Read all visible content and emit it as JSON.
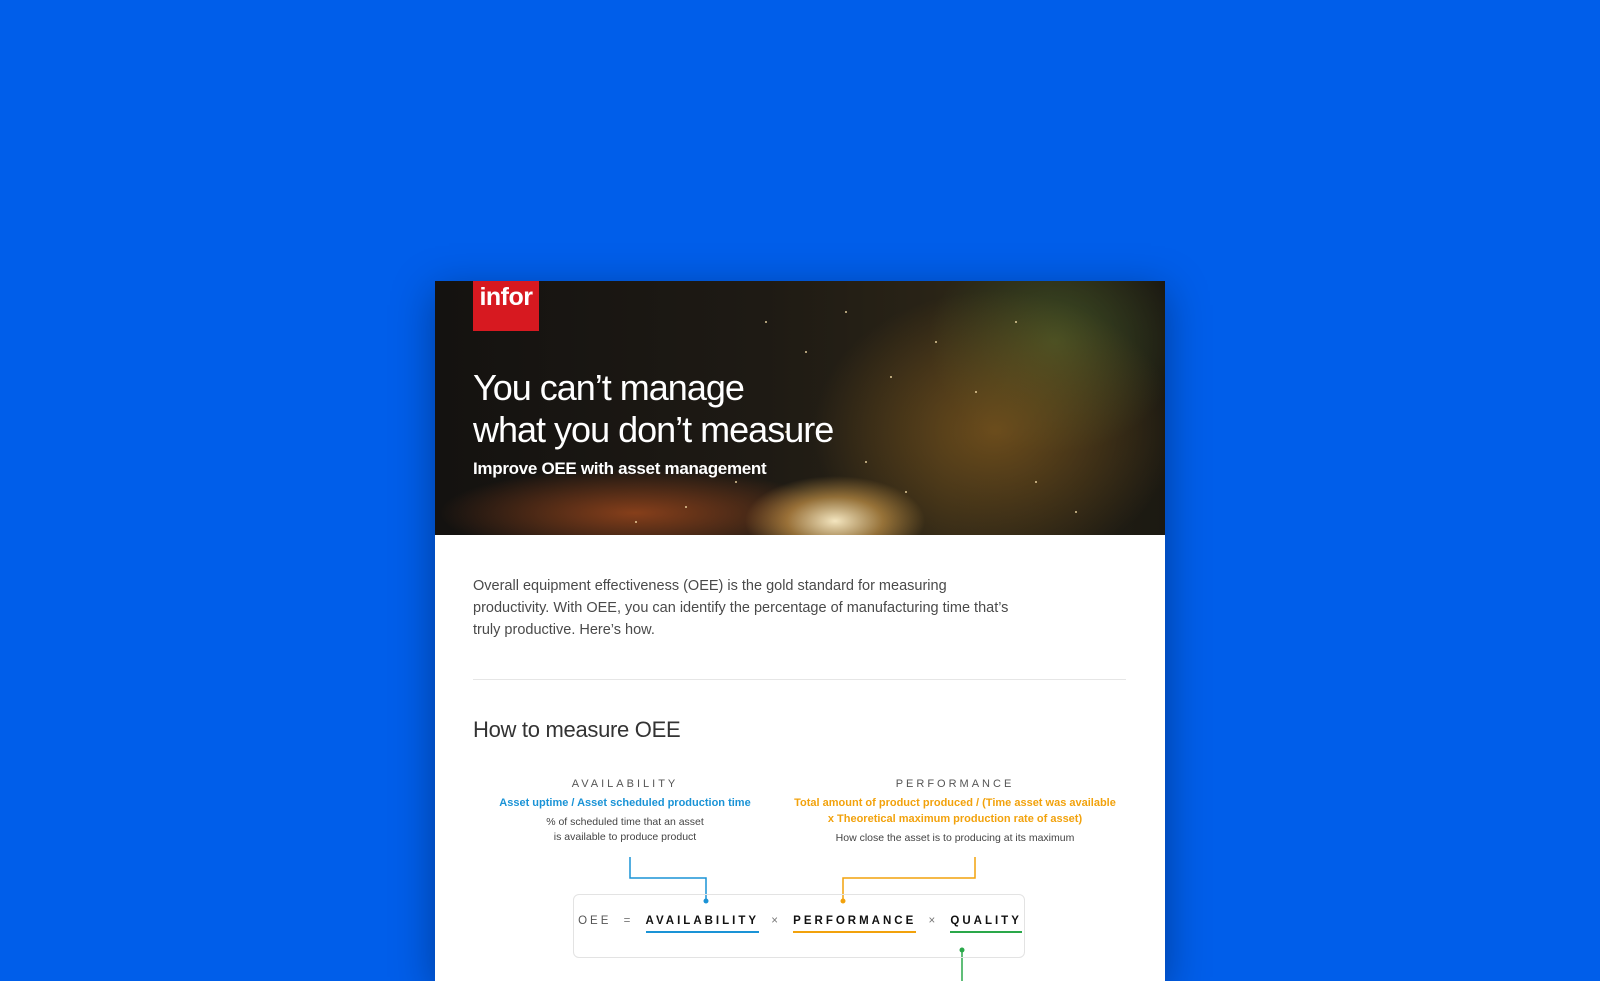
{
  "colors": {
    "background": "#005eea",
    "brand_red": "#d71920",
    "availability": "#1a93d6",
    "performance": "#f2a20c",
    "quality": "#2aa84a"
  },
  "hero": {
    "logo": "infor",
    "title_line1": "You can’t manage",
    "title_line2": "what you don’t measure",
    "subtitle": "Improve OEE with asset management"
  },
  "intro": "Overall equipment effectiveness (OEE) is the gold standard for measuring productivity. With OEE, you can identify the percentage of manufacturing time that’s truly productive. Here’s how.",
  "section_title": "How to measure OEE",
  "availability": {
    "label": "AVAILABILITY",
    "formula": "Asset uptime / Asset scheduled production time",
    "desc_line1": "% of scheduled time that an asset",
    "desc_line2": "is available to produce product"
  },
  "performance": {
    "label": "PERFORMANCE",
    "formula_line1": "Total amount of product produced / (Time asset was available",
    "formula_line2": "x Theoretical maximum production rate of asset)",
    "desc": "How close the asset is to producing at its maximum"
  },
  "equation": {
    "lhs": "OEE",
    "equals": "=",
    "term1": "AVAILABILITY",
    "times1": "×",
    "term2": "PERFORMANCE",
    "times2": "×",
    "term3": "QUALITY"
  }
}
